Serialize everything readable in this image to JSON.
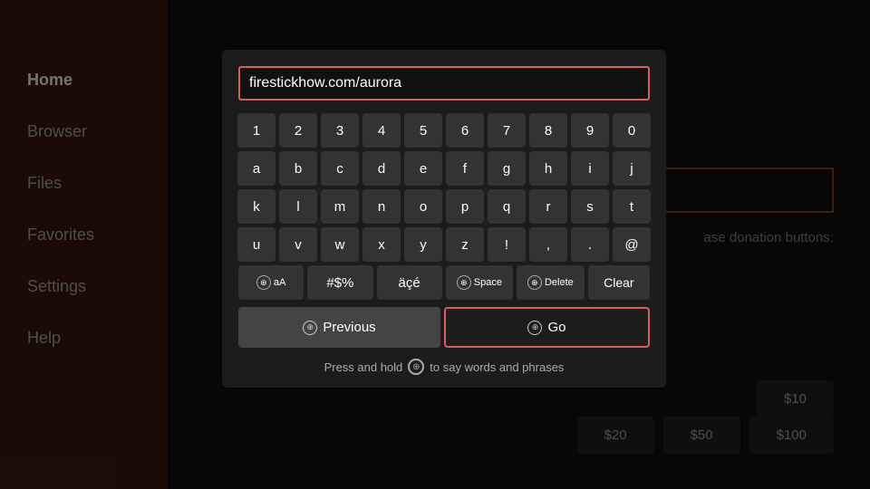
{
  "sidebar": {
    "items": [
      {
        "label": "Home",
        "active": true
      },
      {
        "label": "Browser",
        "active": false
      },
      {
        "label": "Files",
        "active": false
      },
      {
        "label": "Favorites",
        "active": false
      },
      {
        "label": "Settings",
        "active": false
      },
      {
        "label": "Help",
        "active": false
      }
    ]
  },
  "bg": {
    "donation_text": "ase donation buttons:",
    "buttons": [
      "$10",
      "$20",
      "$50",
      "$100"
    ]
  },
  "keyboard": {
    "url_value": "firestickhow.com/aurora",
    "url_placeholder": "firestickhow.com/aurora",
    "rows": [
      [
        "1",
        "2",
        "3",
        "4",
        "5",
        "6",
        "7",
        "8",
        "9",
        "0"
      ],
      [
        "a",
        "b",
        "c",
        "d",
        "e",
        "f",
        "g",
        "h",
        "i",
        "j"
      ],
      [
        "k",
        "l",
        "m",
        "n",
        "o",
        "p",
        "q",
        "r",
        "s",
        "t"
      ],
      [
        "u",
        "v",
        "w",
        "x",
        "y",
        "z",
        "!",
        ",",
        ".",
        "@"
      ]
    ],
    "special_row": [
      {
        "type": "circle-key",
        "icon": "⊕",
        "label": "aA"
      },
      {
        "label": "#$%"
      },
      {
        "label": "äçé"
      },
      {
        "type": "circle-key",
        "icon": "⊕",
        "label": "Space"
      },
      {
        "type": "circle-key",
        "icon": "⊕",
        "label": "Delete"
      },
      {
        "label": "Clear",
        "type": "clear"
      }
    ],
    "previous_label": "Previous",
    "go_label": "Go",
    "voice_hint": "Press and hold",
    "voice_hint2": "to say words and phrases"
  }
}
